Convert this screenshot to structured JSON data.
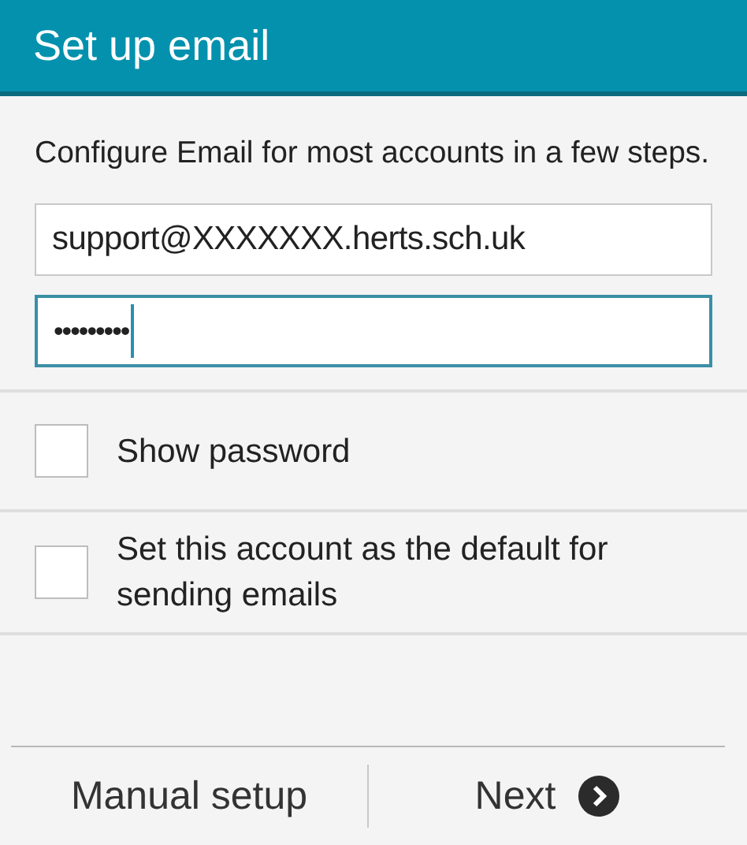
{
  "header": {
    "title": "Set up email"
  },
  "description": "Configure Email for most accounts in a few steps.",
  "fields": [
    {
      "kind": "email",
      "value": "support@XXXXXXX.herts.sch.uk",
      "focused": false
    },
    {
      "kind": "password",
      "value": "•••••••••",
      "focused": true
    }
  ],
  "options": [
    {
      "label": "Show password",
      "checked": false
    },
    {
      "label": "Set this account as the default for sending emails",
      "checked": false
    }
  ],
  "buttons": [
    {
      "label": "Manual setup",
      "kind": "plain"
    },
    {
      "label": "Next",
      "kind": "next"
    }
  ]
}
